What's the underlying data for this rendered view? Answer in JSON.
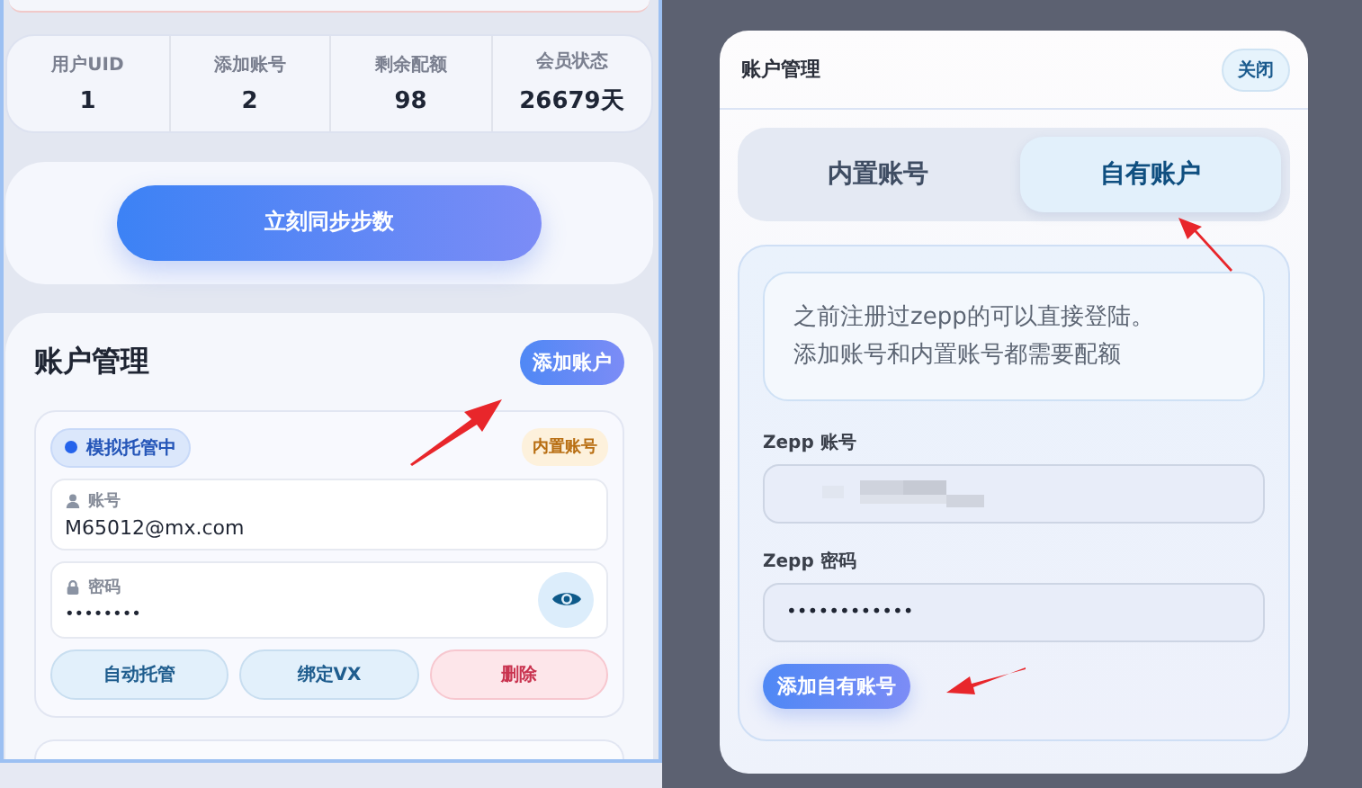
{
  "stats": [
    {
      "label": "用户UID",
      "value": "1"
    },
    {
      "label": "添加账号",
      "value": "2"
    },
    {
      "label": "剩余配额",
      "value": "98"
    },
    {
      "label": "会员状态",
      "value": "26679天"
    }
  ],
  "sync_button": "立刻同步步数",
  "accounts_section": {
    "title": "账户管理",
    "add_button": "添加账户",
    "account": {
      "status": "模拟托管中",
      "type_badge": "内置账号",
      "username_label": "账号",
      "username": "M65012@mx.com",
      "password_label": "密码",
      "password": "••••••••",
      "actions": [
        {
          "label": "自动托管",
          "kind": "primary"
        },
        {
          "label": "绑定VX",
          "kind": "primary"
        },
        {
          "label": "删除",
          "kind": "danger"
        }
      ]
    }
  },
  "modal": {
    "title": "账户管理",
    "close_button": "关闭",
    "tabs": [
      {
        "label": "内置账号",
        "selected": false
      },
      {
        "label": "自有账户",
        "selected": true
      }
    ],
    "notice": [
      "之前注册过zepp的可以直接登陆。",
      "添加账号和内置账号都需要配额"
    ],
    "fields": [
      {
        "label": "Zepp 账号",
        "kind": "redacted"
      },
      {
        "label": "Zepp 密码",
        "kind": "password",
        "value": "••••••••••••"
      }
    ],
    "submit_button": "添加自有账号"
  }
}
